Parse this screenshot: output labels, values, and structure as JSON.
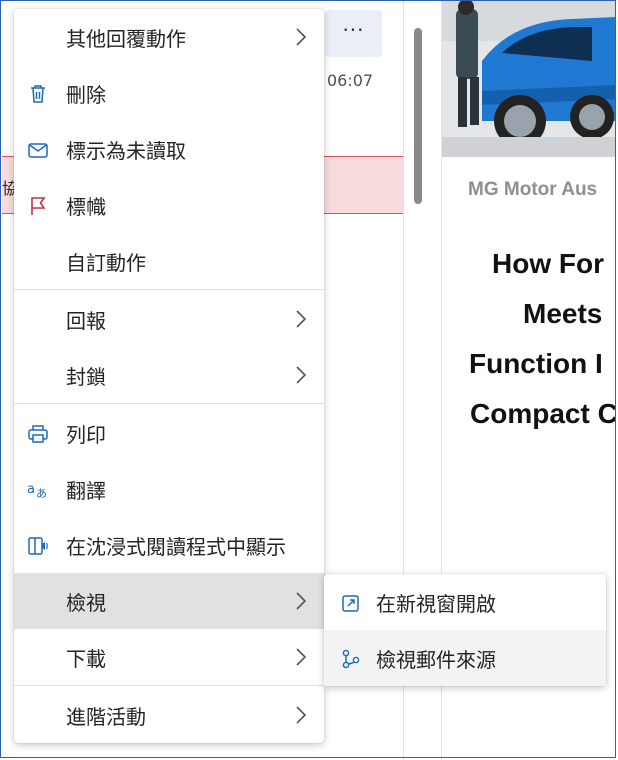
{
  "list": {
    "more_label": "···",
    "time": "06:07",
    "row_fragment": "協"
  },
  "reading": {
    "sender": "MG Motor Aus",
    "headline_lines": [
      "How For",
      "Meets",
      "Function I",
      "Compact C"
    ]
  },
  "menu": {
    "items": [
      {
        "label": "其他回覆動作",
        "icon": "",
        "submenu": true
      },
      {
        "label": "刪除",
        "icon": "trash-icon"
      },
      {
        "label": "標示為未讀取",
        "icon": "envelope-icon"
      },
      {
        "label": "標幟",
        "icon": "flag-icon"
      },
      {
        "label": "自訂動作",
        "icon": ""
      },
      {
        "label": "回報",
        "icon": "",
        "submenu": true
      },
      {
        "label": "封鎖",
        "icon": "",
        "submenu": true
      },
      {
        "label": "列印",
        "icon": "printer-icon"
      },
      {
        "label": "翻譯",
        "icon": "translate-icon"
      },
      {
        "label": "在沈浸式閱讀程式中顯示",
        "icon": "immersive-reader-icon"
      },
      {
        "label": "檢視",
        "icon": "",
        "submenu": true
      },
      {
        "label": "下載",
        "icon": "",
        "submenu": true
      },
      {
        "label": "進階活動",
        "icon": "",
        "submenu": true
      }
    ]
  },
  "submenu": {
    "items": [
      {
        "label": "在新視窗開啟",
        "icon": "open-new-window-icon"
      },
      {
        "label": "檢視郵件來源",
        "icon": "source-branch-icon"
      }
    ]
  },
  "colors": {
    "accent": "#1e6ab9",
    "flag_red": "#c4314b",
    "active_bg": "#e1e1e1",
    "flag_row_bg": "#f8dbdd",
    "frame": "#2f5db8"
  }
}
